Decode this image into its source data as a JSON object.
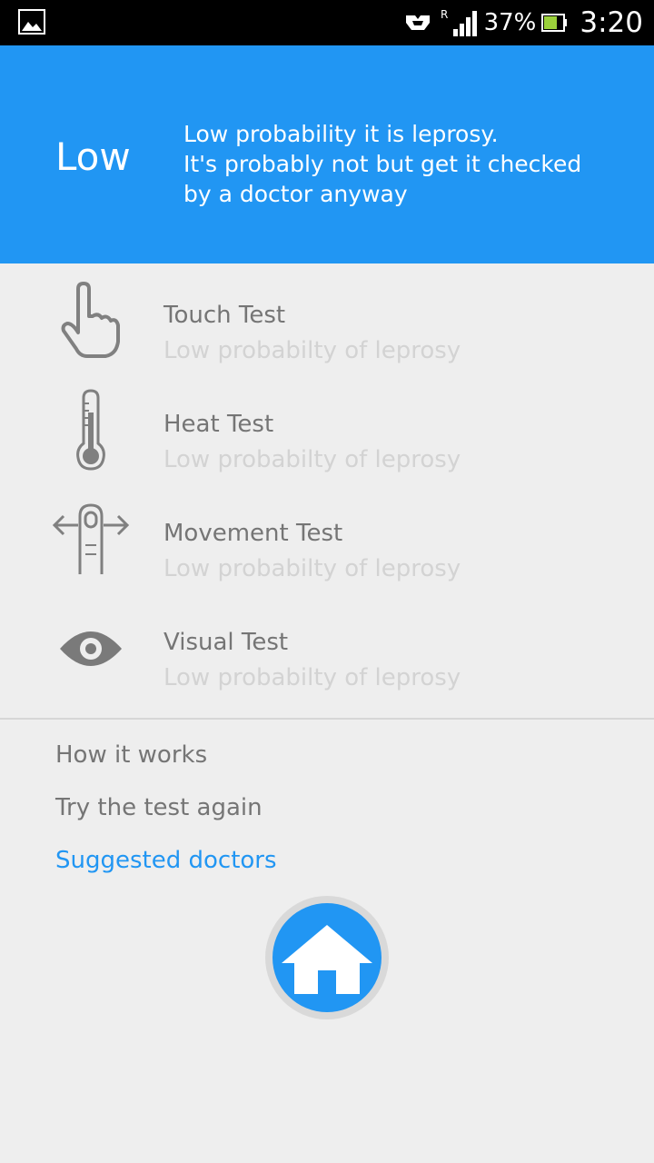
{
  "status_bar": {
    "battery_percent": "37%",
    "time": "3:20",
    "roaming": "R"
  },
  "result": {
    "level": "Low",
    "message_lines": [
      "Low probability it is leprosy.",
      "It's probably not but get it checked",
      "by a doctor anyway"
    ]
  },
  "tests": [
    {
      "icon": "touch-hand-icon",
      "title": "Touch Test",
      "result": "Low probabilty of leprosy"
    },
    {
      "icon": "thermometer-icon",
      "title": "Heat Test",
      "result": "Low probabilty of leprosy"
    },
    {
      "icon": "movement-finger-icon",
      "title": "Movement Test",
      "result": "Low probabilty of leprosy"
    },
    {
      "icon": "eye-icon",
      "title": "Visual Test",
      "result": "Low probabilty of leprosy"
    }
  ],
  "links": {
    "how_it_works": "How it works",
    "try_again": "Try the test again",
    "suggested_doctors": "Suggested doctors"
  },
  "home_button": {
    "icon": "home-icon"
  },
  "colors": {
    "accent": "#2196f3",
    "background": "#eeeeee",
    "title_text": "#757575",
    "subtitle_text": "#d3d3d3"
  }
}
